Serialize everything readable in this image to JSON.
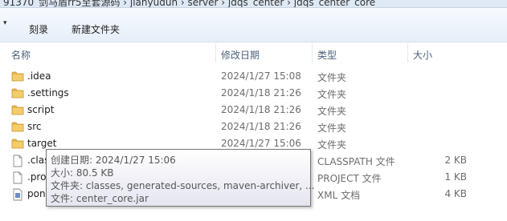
{
  "address_bar": {
    "path": "91370_剑马盾rr5至套源码  ›  jianyudun  ›  server  ›  jdqs_center  ›  jdqs_center_core"
  },
  "toolbar": {
    "burn_label": "刻录",
    "new_folder_label": "新建文件夹"
  },
  "columns": {
    "name": "名称",
    "date": "修改日期",
    "type": "类型",
    "size": "大小"
  },
  "rows": [
    {
      "name": ".idea",
      "date": "2024/1/27 15:08",
      "type": "文件夹",
      "size": "",
      "icon": "folder-icon"
    },
    {
      "name": ".settings",
      "date": "2024/1/18 21:26",
      "type": "文件夹",
      "size": "",
      "icon": "folder-icon"
    },
    {
      "name": "script",
      "date": "2024/1/18 21:26",
      "type": "文件夹",
      "size": "",
      "icon": "folder-icon"
    },
    {
      "name": "src",
      "date": "2024/1/18 21:26",
      "type": "文件夹",
      "size": "",
      "icon": "folder-icon"
    },
    {
      "name": "target",
      "date": "2024/1/27 15:06",
      "type": "文件夹",
      "size": "",
      "icon": "folder-icon"
    },
    {
      "name": ".clas",
      "date": "",
      "type": "CLASSPATH 文件",
      "size": "2 KB",
      "icon": "file-icon"
    },
    {
      "name": ".pro",
      "date": "",
      "type": "PROJECT 文件",
      "size": "1 KB",
      "icon": "file-icon"
    },
    {
      "name": "pon",
      "date": "",
      "type": "XML 文档",
      "size": "4 KB",
      "icon": "xml-file-icon"
    }
  ],
  "tooltip": {
    "created": "创建日期: 2024/1/27 15:06",
    "size": "大小: 80.5 KB",
    "folders": "文件夹: classes, generated-sources, maven-archiver, ...",
    "files": "文件: center_core.jar"
  },
  "colors": {
    "folder": "#e8b64a",
    "header_text": "#4c607a",
    "toolbar_top": "#f7fbff",
    "toolbar_bottom": "#e6eef8"
  }
}
